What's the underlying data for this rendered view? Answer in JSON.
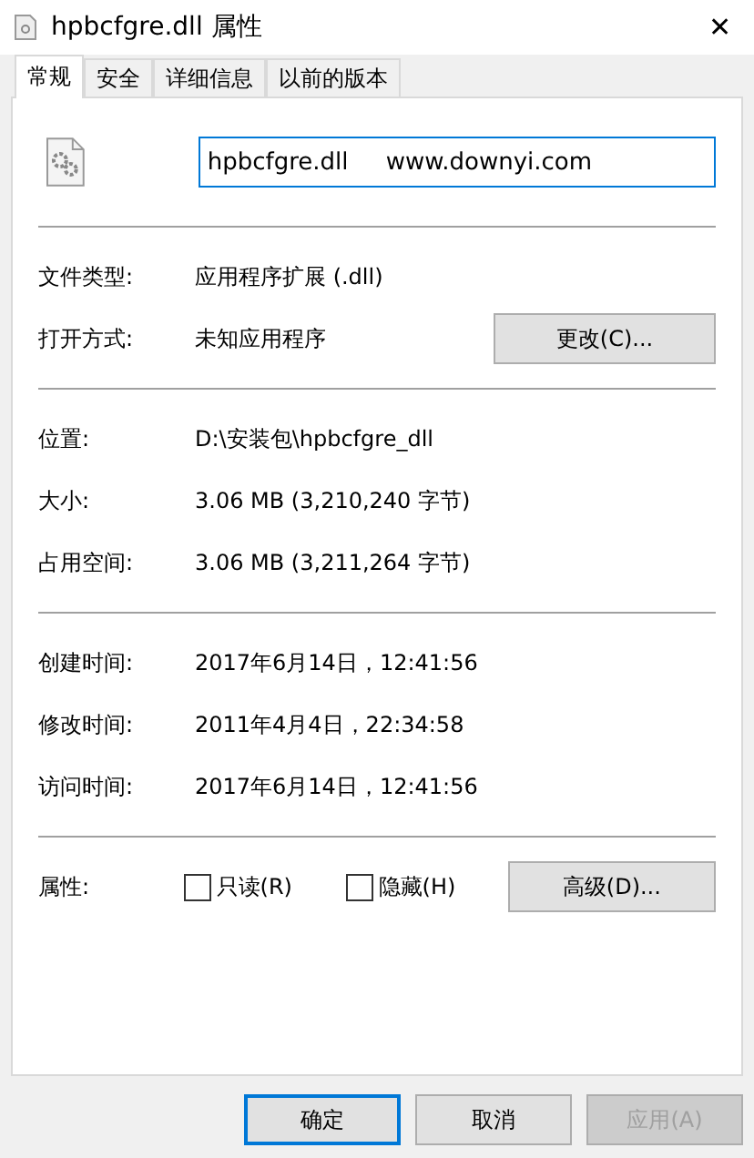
{
  "window": {
    "title": "hpbcfgre.dll 属性",
    "close": "✕"
  },
  "tabs": [
    {
      "label": "常规",
      "selected": true
    },
    {
      "label": "安全",
      "selected": false
    },
    {
      "label": "详细信息",
      "selected": false
    },
    {
      "label": "以前的版本",
      "selected": false
    }
  ],
  "name_field": {
    "value": "hpbcfgre.dll     www.downyi.com"
  },
  "sections": [
    [
      {
        "label": "文件类型:",
        "value": "应用程序扩展 (.dll)"
      },
      {
        "label": "打开方式:",
        "value": "未知应用程序",
        "button": "更改(C)..."
      }
    ],
    [
      {
        "label": "位置:",
        "value": "D:\\安装包\\hpbcfgre_dll"
      },
      {
        "label": "大小:",
        "value": "3.06 MB (3,210,240 字节)"
      },
      {
        "label": "占用空间:",
        "value": "3.06 MB (3,211,264 字节)"
      }
    ],
    [
      {
        "label": "创建时间:",
        "value": "2017年6月14日，12:41:56"
      },
      {
        "label": "修改时间:",
        "value": "2011年4月4日，22:34:58"
      },
      {
        "label": "访问时间:",
        "value": "2017年6月14日，12:41:56"
      }
    ]
  ],
  "attributes": {
    "label": "属性:",
    "checkboxes": [
      {
        "label": "只读(R)",
        "checked": false
      },
      {
        "label": "隐藏(H)",
        "checked": false
      }
    ],
    "button": "高级(D)..."
  },
  "buttons": [
    {
      "label": "确定",
      "default": true,
      "disabled": false
    },
    {
      "label": "取消",
      "default": false,
      "disabled": false
    },
    {
      "label": "应用(A)",
      "default": false,
      "disabled": true
    }
  ]
}
